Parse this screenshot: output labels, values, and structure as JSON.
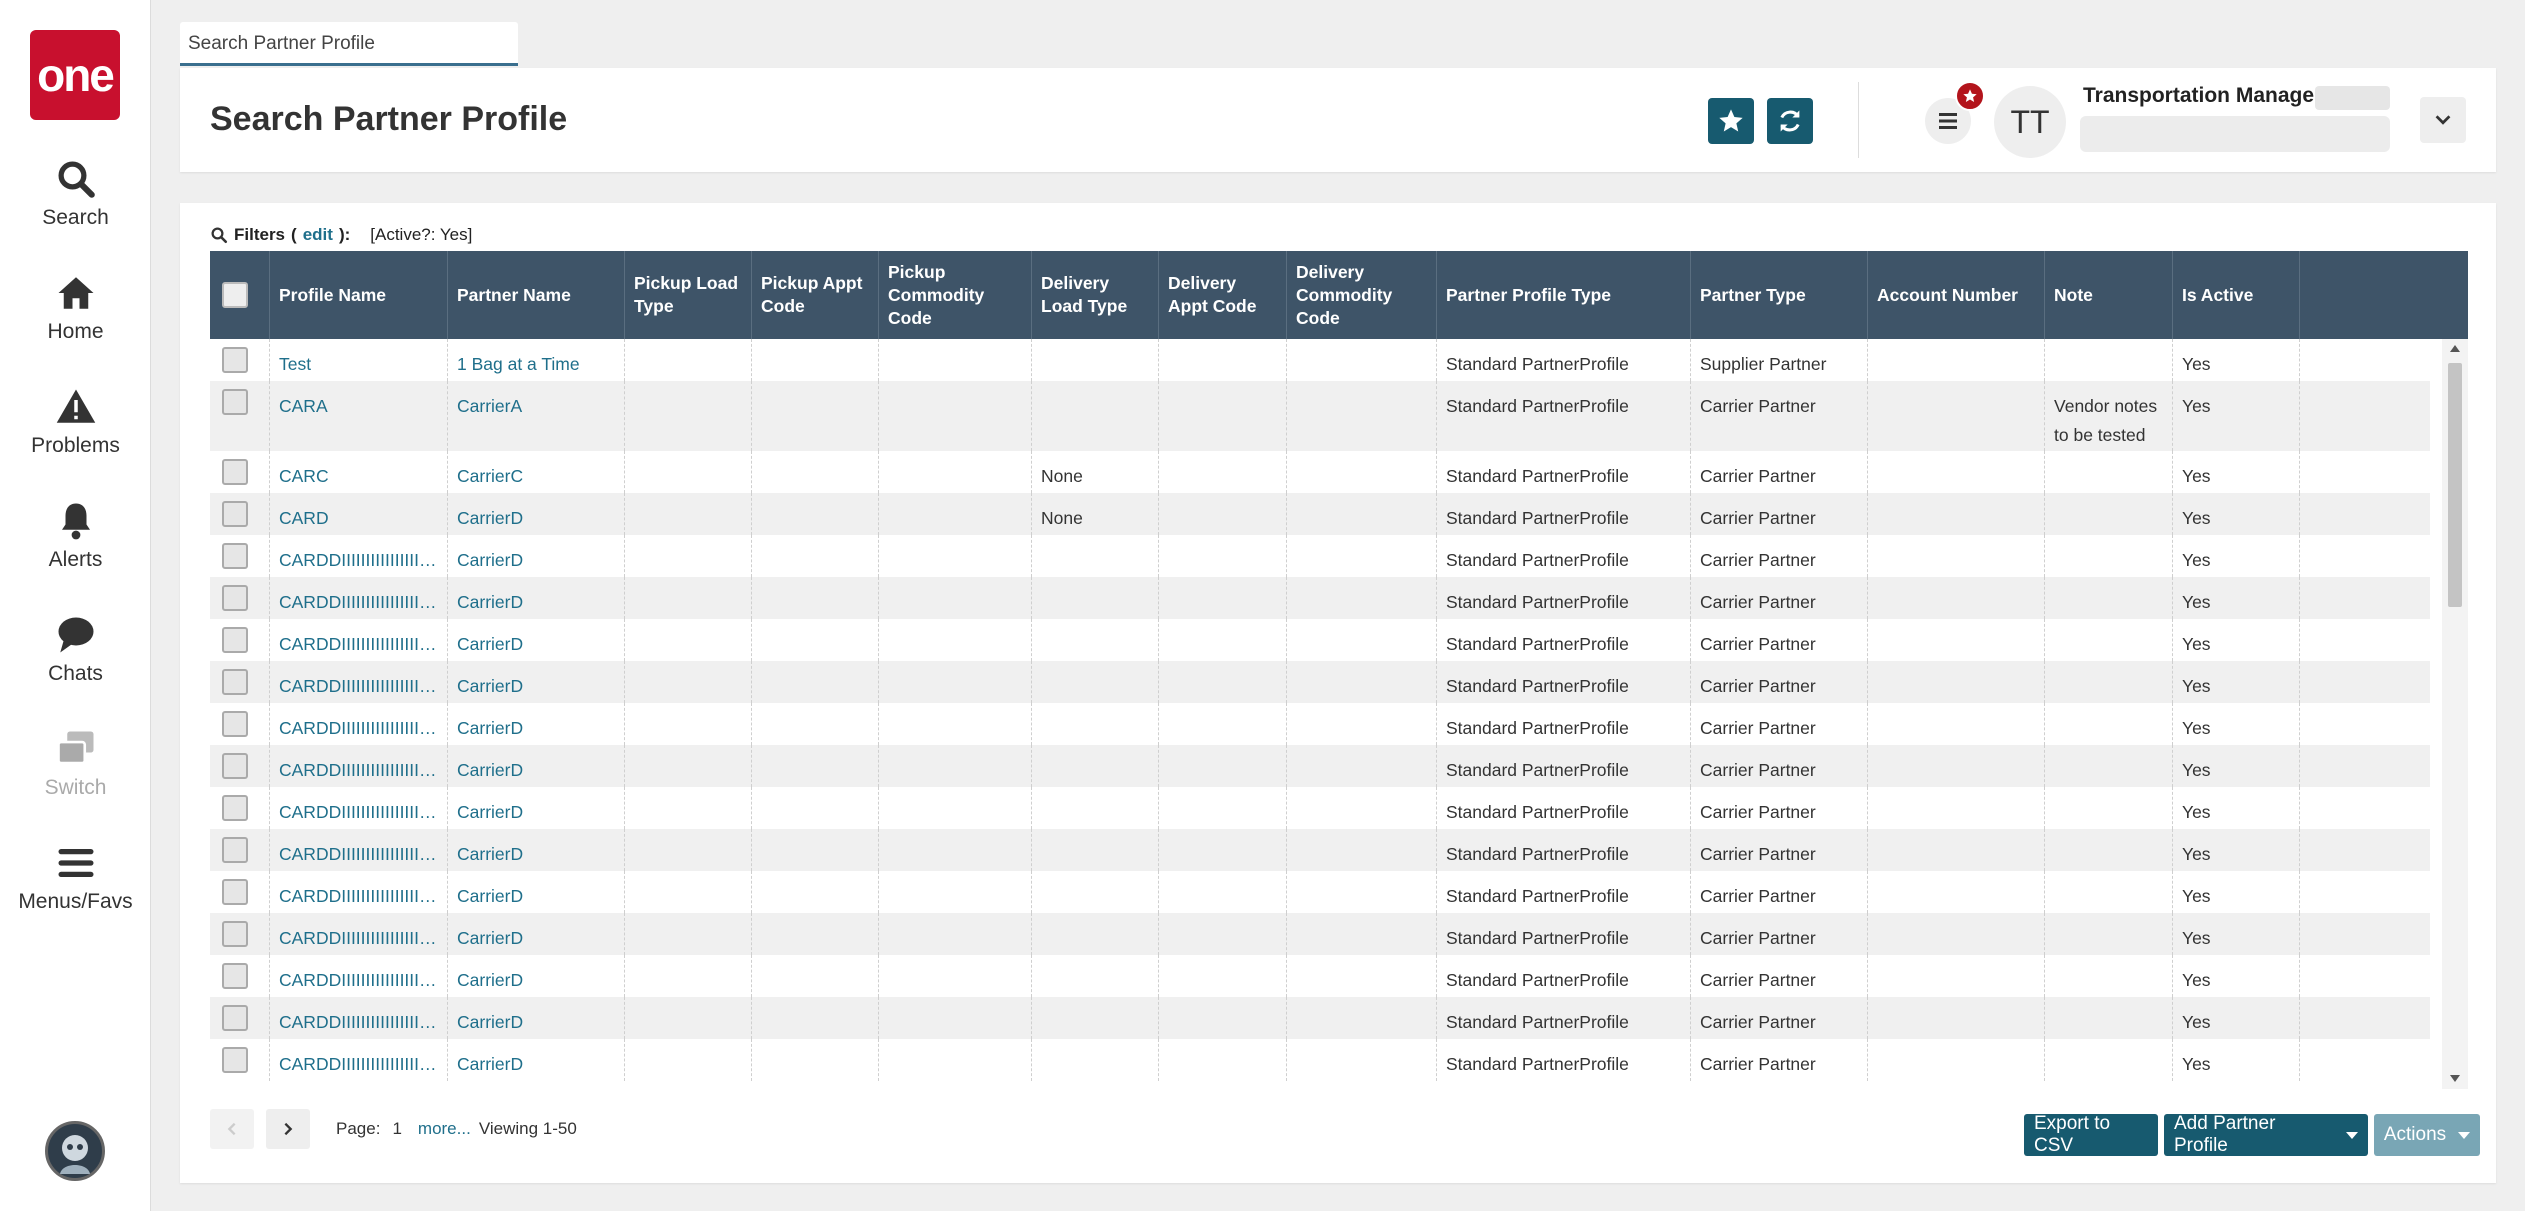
{
  "nav": {
    "logo": "one",
    "items": [
      {
        "label": "Search",
        "icon": "search-icon",
        "disabled": false
      },
      {
        "label": "Home",
        "icon": "home-icon",
        "disabled": false
      },
      {
        "label": "Problems",
        "icon": "warning-icon",
        "disabled": false
      },
      {
        "label": "Alerts",
        "icon": "bell-icon",
        "disabled": false
      },
      {
        "label": "Chats",
        "icon": "chat-bubble-icon",
        "disabled": false
      },
      {
        "label": "Switch",
        "icon": "switch-windows-icon",
        "disabled": true
      },
      {
        "label": "Menus/Favs",
        "icon": "hamburger-icon",
        "disabled": false
      }
    ]
  },
  "tab": {
    "label": "Search Partner Profile"
  },
  "header": {
    "title": "Search Partner Profile",
    "user_initials": "TT",
    "user_name": "Transportation Manager"
  },
  "filters": {
    "label": "Filters",
    "edit": "edit",
    "criteria": "[Active?: Yes]"
  },
  "table": {
    "columns": [
      "Profile Name",
      "Partner Name",
      "Pickup Load Type",
      "Pickup Appt Code",
      "Pickup Commodity Code",
      "Delivery Load Type",
      "Delivery Appt Code",
      "Delivery Commodity Code",
      "Partner Profile Type",
      "Partner Type",
      "Account Number",
      "Note",
      "Is Active"
    ],
    "rows": [
      [
        "Test",
        "1 Bag at a Time",
        "",
        "",
        "",
        "",
        "",
        "",
        "Standard PartnerProfile",
        "Supplier Partner",
        "",
        "",
        "Yes"
      ],
      [
        "CARA",
        "CarrierA",
        "",
        "",
        "",
        "",
        "",
        "",
        "Standard PartnerProfile",
        "Carrier Partner",
        "",
        "Vendor notes to be tested",
        "Yes"
      ],
      [
        "CARC",
        "CarrierC",
        "",
        "",
        "",
        "None",
        "",
        "",
        "Standard PartnerProfile",
        "Carrier Partner",
        "",
        "",
        "Yes"
      ],
      [
        "CARD",
        "CarrierD",
        "",
        "",
        "",
        "None",
        "",
        "",
        "Standard PartnerProfile",
        "Carrier Partner",
        "",
        "",
        "Yes"
      ],
      [
        "CARDDIIIIIIIIIIIIIIIIIIIIIIIII...",
        "CarrierD",
        "",
        "",
        "",
        "",
        "",
        "",
        "Standard PartnerProfile",
        "Carrier Partner",
        "",
        "",
        "Yes"
      ],
      [
        "CARDDIIIIIIIIIIIIIIIIIIIIIIIII...",
        "CarrierD",
        "",
        "",
        "",
        "",
        "",
        "",
        "Standard PartnerProfile",
        "Carrier Partner",
        "",
        "",
        "Yes"
      ],
      [
        "CARDDIIIIIIIIIIIIIIIIIIIIIIIII...",
        "CarrierD",
        "",
        "",
        "",
        "",
        "",
        "",
        "Standard PartnerProfile",
        "Carrier Partner",
        "",
        "",
        "Yes"
      ],
      [
        "CARDDIIIIIIIIIIIIIIIIIIIIIIIII...",
        "CarrierD",
        "",
        "",
        "",
        "",
        "",
        "",
        "Standard PartnerProfile",
        "Carrier Partner",
        "",
        "",
        "Yes"
      ],
      [
        "CARDDIIIIIIIIIIIIIIIIIIIIIIIII...",
        "CarrierD",
        "",
        "",
        "",
        "",
        "",
        "",
        "Standard PartnerProfile",
        "Carrier Partner",
        "",
        "",
        "Yes"
      ],
      [
        "CARDDIIIIIIIIIIIIIIIIIIIIIIIII...",
        "CarrierD",
        "",
        "",
        "",
        "",
        "",
        "",
        "Standard PartnerProfile",
        "Carrier Partner",
        "",
        "",
        "Yes"
      ],
      [
        "CARDDIIIIIIIIIIIIIIIIIIIIIIIII...",
        "CarrierD",
        "",
        "",
        "",
        "",
        "",
        "",
        "Standard PartnerProfile",
        "Carrier Partner",
        "",
        "",
        "Yes"
      ],
      [
        "CARDDIIIIIIIIIIIIIIIIIIIIIIIII...",
        "CarrierD",
        "",
        "",
        "",
        "",
        "",
        "",
        "Standard PartnerProfile",
        "Carrier Partner",
        "",
        "",
        "Yes"
      ],
      [
        "CARDDIIIIIIIIIIIIIIIIIIIIIIIII...",
        "CarrierD",
        "",
        "",
        "",
        "",
        "",
        "",
        "Standard PartnerProfile",
        "Carrier Partner",
        "",
        "",
        "Yes"
      ],
      [
        "CARDDIIIIIIIIIIIIIIIIIIIIIIIII...",
        "CarrierD",
        "",
        "",
        "",
        "",
        "",
        "",
        "Standard PartnerProfile",
        "Carrier Partner",
        "",
        "",
        "Yes"
      ],
      [
        "CARDDIIIIIIIIIIIIIIIIIIIIIIIII...",
        "CarrierD",
        "",
        "",
        "",
        "",
        "",
        "",
        "Standard PartnerProfile",
        "Carrier Partner",
        "",
        "",
        "Yes"
      ],
      [
        "CARDDIIIIIIIIIIIIIIIIIIIIIIIII...",
        "CarrierD",
        "",
        "",
        "",
        "",
        "",
        "",
        "Standard PartnerProfile",
        "Carrier Partner",
        "",
        "",
        "Yes"
      ],
      [
        "CARDDIIIIIIIIIIIIIIIIIIIIIIIII...",
        "CarrierD",
        "",
        "",
        "",
        "",
        "",
        "",
        "Standard PartnerProfile",
        "Carrier Partner",
        "",
        "",
        "Yes"
      ]
    ]
  },
  "pager": {
    "page_label": "Page:",
    "page": "1",
    "more": "more...",
    "viewing": "Viewing 1-50"
  },
  "buttons": {
    "export": "Export to CSV",
    "add": "Add Partner Profile",
    "actions": "Actions"
  },
  "colors": {
    "brand_red": "#c8102e",
    "header_dark": "#3e5468",
    "primary_button": "#175a6f",
    "link": "#1f6f8b",
    "disabled_button": "#79a6b5"
  }
}
